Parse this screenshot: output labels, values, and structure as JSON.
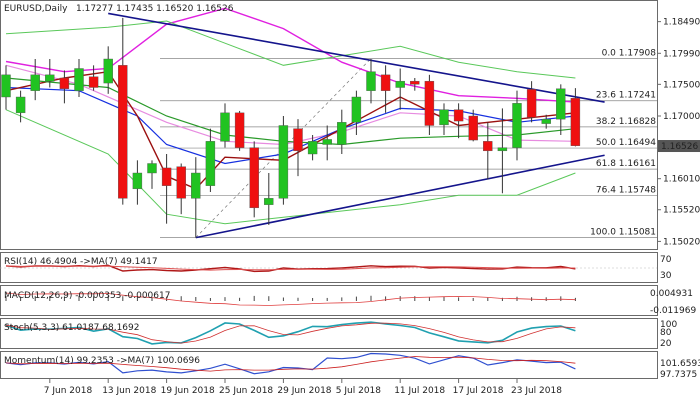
{
  "header": {
    "symbol_label": "EURUSD,Daily",
    "ohlc_text": "1.17277 1.17435 1.16520 1.16526"
  },
  "colors": {
    "bull": "#21c321",
    "bear": "#ef1010",
    "wick": "#333333",
    "ma_magenta": "#e020e0",
    "ma_pink": "#e78be0",
    "ma_blue": "#1630e0",
    "ma_red": "#9b1010",
    "ma_green": "#2a9a2a",
    "bb": "#5ac85a",
    "trendline": "#14148c",
    "fib_line": "#888888",
    "fib_text": "#444444",
    "rsi": "#b01818",
    "rsi_ma": "#e05050",
    "macd": "#444444",
    "macd_signal": "#e04040",
    "stoch_k": "#20a0b0",
    "stoch_d": "#d03030",
    "momentum": "#3050d0",
    "momentum_ma": "#cc2020",
    "current_price_bg": "#555555"
  },
  "chart_data": {
    "type": "candlestick",
    "x_labels": [
      "7 Jun 2018",
      "13 Jun 2018",
      "19 Jun 2018",
      "25 Jun 2018",
      "29 Jun 2018",
      "5 Jul 2018",
      "11 Jul 2018",
      "17 Jul 2018",
      "23 Jul 2018"
    ],
    "y_ticks": [
      "1.18490",
      "1.17990",
      "1.17500",
      "1.17000",
      "1.16010",
      "1.15520",
      "1.15020"
    ],
    "ylim": [
      1.149,
      1.188
    ],
    "current_price": "1.16526",
    "candles": [
      {
        "d": "2018-06-04",
        "o": 1.173,
        "h": 1.178,
        "l": 1.171,
        "c": 1.1765
      },
      {
        "d": "2018-06-05",
        "o": 1.1705,
        "h": 1.174,
        "l": 1.169,
        "c": 1.173
      },
      {
        "d": "2018-06-06",
        "o": 1.174,
        "h": 1.179,
        "l": 1.1725,
        "c": 1.1765
      },
      {
        "d": "2018-06-07",
        "o": 1.1755,
        "h": 1.179,
        "l": 1.1745,
        "c": 1.1765
      },
      {
        "d": "2018-06-08",
        "o": 1.176,
        "h": 1.1772,
        "l": 1.172,
        "c": 1.1743
      },
      {
        "d": "2018-06-11",
        "o": 1.174,
        "h": 1.179,
        "l": 1.173,
        "c": 1.1775
      },
      {
        "d": "2018-06-12",
        "o": 1.1762,
        "h": 1.178,
        "l": 1.174,
        "c": 1.1745
      },
      {
        "d": "2018-06-13",
        "o": 1.1752,
        "h": 1.181,
        "l": 1.1735,
        "c": 1.179
      },
      {
        "d": "2018-06-14",
        "o": 1.178,
        "h": 1.1855,
        "l": 1.156,
        "c": 1.157
      },
      {
        "d": "2018-06-15",
        "o": 1.1585,
        "h": 1.163,
        "l": 1.156,
        "c": 1.161
      },
      {
        "d": "2018-06-18",
        "o": 1.161,
        "h": 1.163,
        "l": 1.1585,
        "c": 1.1625
      },
      {
        "d": "2018-06-19",
        "o": 1.1618,
        "h": 1.164,
        "l": 1.153,
        "c": 1.159
      },
      {
        "d": "2018-06-20",
        "o": 1.162,
        "h": 1.1625,
        "l": 1.1545,
        "c": 1.157
      },
      {
        "d": "2018-06-21",
        "o": 1.157,
        "h": 1.1635,
        "l": 1.1508,
        "c": 1.161
      },
      {
        "d": "2018-06-22",
        "o": 1.159,
        "h": 1.168,
        "l": 1.158,
        "c": 1.166
      },
      {
        "d": "2018-06-25",
        "o": 1.166,
        "h": 1.172,
        "l": 1.165,
        "c": 1.1705
      },
      {
        "d": "2018-06-26",
        "o": 1.1705,
        "h": 1.1708,
        "l": 1.1645,
        "c": 1.165
      },
      {
        "d": "2018-06-27",
        "o": 1.165,
        "h": 1.166,
        "l": 1.154,
        "c": 1.1555
      },
      {
        "d": "2018-06-28",
        "o": 1.156,
        "h": 1.161,
        "l": 1.1528,
        "c": 1.157
      },
      {
        "d": "2018-06-29",
        "o": 1.157,
        "h": 1.17,
        "l": 1.156,
        "c": 1.1685
      },
      {
        "d": "2018-07-02",
        "o": 1.168,
        "h": 1.1695,
        "l": 1.1605,
        "c": 1.1645
      },
      {
        "d": "2018-07-03",
        "o": 1.164,
        "h": 1.167,
        "l": 1.163,
        "c": 1.166
      },
      {
        "d": "2018-07-04",
        "o": 1.1655,
        "h": 1.1685,
        "l": 1.163,
        "c": 1.1663
      },
      {
        "d": "2018-07-05",
        "o": 1.1655,
        "h": 1.171,
        "l": 1.164,
        "c": 1.169
      },
      {
        "d": "2018-07-06",
        "o": 1.169,
        "h": 1.174,
        "l": 1.167,
        "c": 1.173
      },
      {
        "d": "2018-07-09",
        "o": 1.174,
        "h": 1.179,
        "l": 1.172,
        "c": 1.177
      },
      {
        "d": "2018-07-10",
        "o": 1.1765,
        "h": 1.178,
        "l": 1.1705,
        "c": 1.174
      },
      {
        "d": "2018-07-11",
        "o": 1.1745,
        "h": 1.1775,
        "l": 1.171,
        "c": 1.1755
      },
      {
        "d": "2018-07-12",
        "o": 1.1755,
        "h": 1.176,
        "l": 1.174,
        "c": 1.175
      },
      {
        "d": "2018-07-13",
        "o": 1.1755,
        "h": 1.1765,
        "l": 1.167,
        "c": 1.1685
      },
      {
        "d": "2018-07-16",
        "o": 1.1686,
        "h": 1.172,
        "l": 1.167,
        "c": 1.171
      },
      {
        "d": "2018-07-17",
        "o": 1.171,
        "h": 1.172,
        "l": 1.1665,
        "c": 1.1692
      },
      {
        "d": "2018-07-18",
        "o": 1.17,
        "h": 1.171,
        "l": 1.166,
        "c": 1.1662
      },
      {
        "d": "2018-07-19",
        "o": 1.166,
        "h": 1.169,
        "l": 1.16,
        "c": 1.1645
      },
      {
        "d": "2018-07-20",
        "o": 1.1645,
        "h": 1.1712,
        "l": 1.1578,
        "c": 1.165
      },
      {
        "d": "2018-07-23",
        "o": 1.165,
        "h": 1.174,
        "l": 1.163,
        "c": 1.172
      },
      {
        "d": "2018-07-24",
        "o": 1.1742,
        "h": 1.1755,
        "l": 1.169,
        "c": 1.1698
      },
      {
        "d": "2018-07-25",
        "o": 1.1688,
        "h": 1.1702,
        "l": 1.168,
        "c": 1.1695
      },
      {
        "d": "2018-07-26",
        "o": 1.1695,
        "h": 1.175,
        "l": 1.167,
        "c": 1.1743
      },
      {
        "d": "2018-07-27",
        "o": 1.1728,
        "h": 1.1744,
        "l": 1.1652,
        "c": 1.1653
      }
    ],
    "fib_levels": [
      {
        "label": "0.0 1.17908",
        "value": 1.17908
      },
      {
        "label": "23.6 1.17241",
        "value": 1.17241
      },
      {
        "label": "38.2 1.16828",
        "value": 1.16828
      },
      {
        "label": "50.0 1.16494",
        "value": 1.16494
      },
      {
        "label": "61.8 1.16161",
        "value": 1.16161
      },
      {
        "label": "76.4 1.15748",
        "value": 1.15748
      },
      {
        "label": "100.0 1.15081",
        "value": 1.15081
      }
    ],
    "trendlines": [
      {
        "from": {
          "d": "2018-06-13",
          "v": 1.1862
        },
        "to": {
          "d": "2018-07-31",
          "v": 1.1722
        }
      },
      {
        "from": {
          "d": "2018-06-21",
          "v": 1.1508
        },
        "to": {
          "d": "2018-07-31",
          "v": 1.1638
        }
      }
    ],
    "moving_averages": [
      {
        "color": "ma_magenta",
        "width": 1.4,
        "points": [
          [
            "2018-06-04",
            1.1786
          ],
          [
            "2018-06-08",
            1.177
          ],
          [
            "2018-06-13",
            1.1775
          ],
          [
            "2018-06-19",
            1.1845
          ],
          [
            "2018-06-25",
            1.187
          ],
          [
            "2018-06-29",
            1.1838
          ],
          [
            "2018-07-05",
            1.1785
          ],
          [
            "2018-07-11",
            1.1752
          ],
          [
            "2018-07-17",
            1.1732
          ],
          [
            "2018-07-23",
            1.1728
          ],
          [
            "2018-07-27",
            1.1722
          ]
        ]
      },
      {
        "color": "ma_pink",
        "width": 1.2,
        "points": [
          [
            "2018-06-04",
            1.178
          ],
          [
            "2018-06-11",
            1.175
          ],
          [
            "2018-06-19",
            1.169
          ],
          [
            "2018-06-25",
            1.166
          ],
          [
            "2018-06-29",
            1.1655
          ],
          [
            "2018-07-05",
            1.1675
          ],
          [
            "2018-07-11",
            1.1705
          ],
          [
            "2018-07-17",
            1.17
          ],
          [
            "2018-07-23",
            1.1662
          ],
          [
            "2018-07-27",
            1.166
          ]
        ]
      },
      {
        "color": "ma_blue",
        "width": 1.2,
        "points": [
          [
            "2018-06-04",
            1.1745
          ],
          [
            "2018-06-11",
            1.174
          ],
          [
            "2018-06-15",
            1.17
          ],
          [
            "2018-06-19",
            1.1655
          ],
          [
            "2018-06-25",
            1.1625
          ],
          [
            "2018-06-29",
            1.164
          ],
          [
            "2018-07-05",
            1.168
          ],
          [
            "2018-07-11",
            1.1712
          ],
          [
            "2018-07-17",
            1.1708
          ],
          [
            "2018-07-23",
            1.169
          ],
          [
            "2018-07-27",
            1.17
          ]
        ]
      },
      {
        "color": "ma_red",
        "width": 1.4,
        "points": [
          [
            "2018-06-04",
            1.174
          ],
          [
            "2018-06-08",
            1.176
          ],
          [
            "2018-06-13",
            1.177
          ],
          [
            "2018-06-15",
            1.17
          ],
          [
            "2018-06-19",
            1.1605
          ],
          [
            "2018-06-21",
            1.1585
          ],
          [
            "2018-06-25",
            1.1635
          ],
          [
            "2018-06-29",
            1.163
          ],
          [
            "2018-07-05",
            1.168
          ],
          [
            "2018-07-11",
            1.173
          ],
          [
            "2018-07-17",
            1.1685
          ],
          [
            "2018-07-23",
            1.1695
          ],
          [
            "2018-07-27",
            1.1705
          ]
        ]
      },
      {
        "color": "ma_green",
        "width": 1.2,
        "points": [
          [
            "2018-06-04",
            1.176
          ],
          [
            "2018-06-13",
            1.1745
          ],
          [
            "2018-06-19",
            1.17
          ],
          [
            "2018-06-25",
            1.167
          ],
          [
            "2018-06-29",
            1.166
          ],
          [
            "2018-07-05",
            1.1655
          ],
          [
            "2018-07-11",
            1.1665
          ],
          [
            "2018-07-17",
            1.1668
          ],
          [
            "2018-07-23",
            1.167
          ],
          [
            "2018-07-27",
            1.168
          ]
        ]
      },
      {
        "color": "bb",
        "width": 1,
        "points": [
          [
            "2018-06-04",
            1.183
          ],
          [
            "2018-06-13",
            1.184
          ],
          [
            "2018-06-19",
            1.185
          ],
          [
            "2018-06-25",
            1.1815
          ],
          [
            "2018-06-29",
            1.178
          ],
          [
            "2018-07-05",
            1.1795
          ],
          [
            "2018-07-11",
            1.181
          ],
          [
            "2018-07-17",
            1.1785
          ],
          [
            "2018-07-23",
            1.177
          ],
          [
            "2018-07-27",
            1.176
          ]
        ]
      },
      {
        "color": "bb",
        "width": 1,
        "points": [
          [
            "2018-06-04",
            1.171
          ],
          [
            "2018-06-13",
            1.164
          ],
          [
            "2018-06-19",
            1.1545
          ],
          [
            "2018-06-25",
            1.153
          ],
          [
            "2018-06-29",
            1.154
          ],
          [
            "2018-07-05",
            1.155
          ],
          [
            "2018-07-11",
            1.156
          ],
          [
            "2018-07-17",
            1.1575
          ],
          [
            "2018-07-23",
            1.1575
          ],
          [
            "2018-07-27",
            1.161
          ]
        ]
      }
    ],
    "indicators": {
      "rsi": {
        "label": "RSI(14) 46.4904  ->MA(7) 49.1417",
        "ticks": [
          "70",
          "30"
        ]
      },
      "macd": {
        "label": "MACD(12,26,9) -0.000353 -0.000617",
        "ticks": [
          "0.004931",
          "-0.011969"
        ]
      },
      "stoch": {
        "label": "Stoch(5,3,3) 61.0187 68.1692",
        "ticks": [
          "100",
          "80",
          "20",
          "0"
        ]
      },
      "momentum": {
        "label": "Momentum(14) 99.2353  ->MA(7) 100.0696",
        "ticks": [
          "101.6593",
          "97.7375"
        ]
      }
    }
  }
}
